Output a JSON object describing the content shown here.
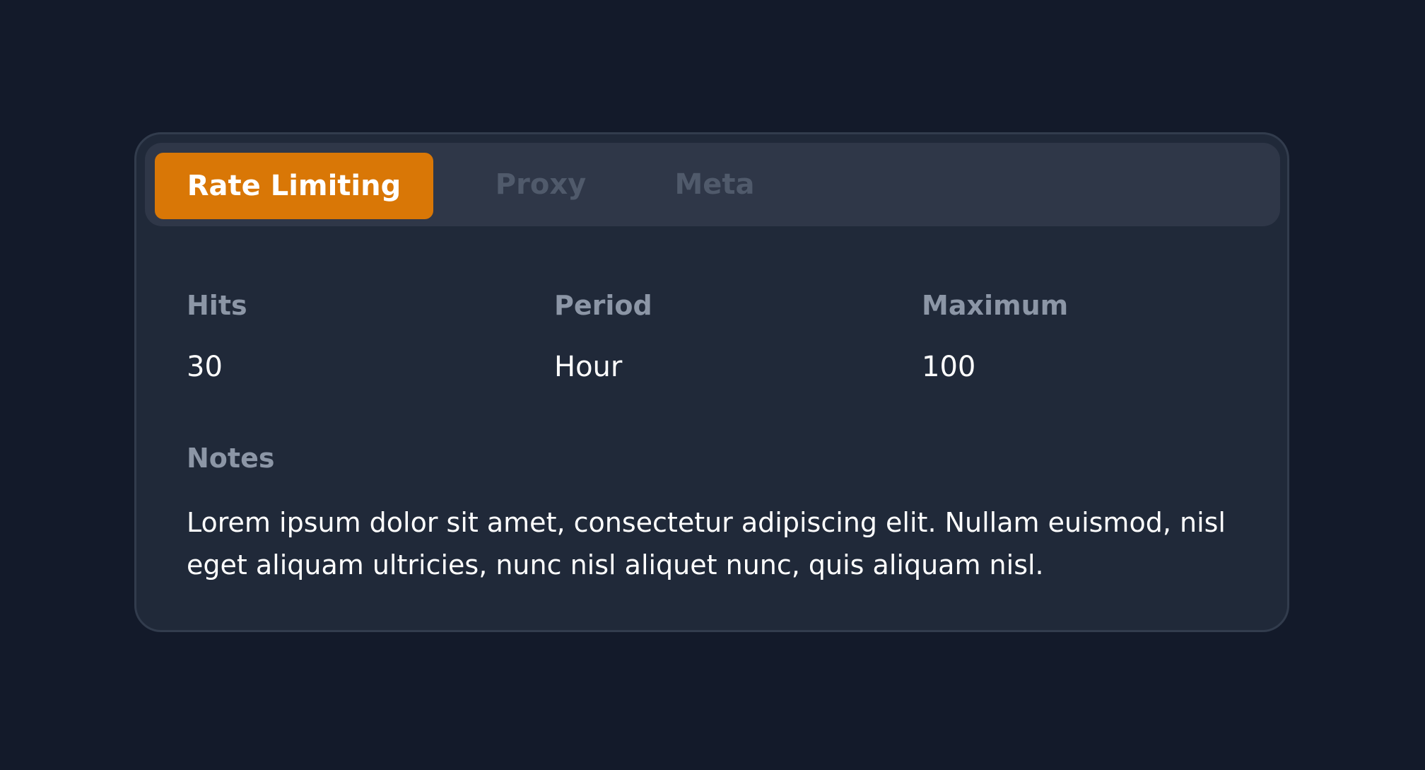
{
  "tabs": [
    {
      "label": "Rate Limiting",
      "active": true
    },
    {
      "label": "Proxy",
      "active": false
    },
    {
      "label": "Meta",
      "active": false
    }
  ],
  "fields": {
    "hits": {
      "label": "Hits",
      "value": "30"
    },
    "period": {
      "label": "Period",
      "value": "Hour"
    },
    "maximum": {
      "label": "Maximum",
      "value": "100"
    }
  },
  "notes": {
    "label": "Notes",
    "text": "Lorem ipsum dolor sit amet, consectetur adipiscing elit. Nullam euismod, nisl eget aliquam ultricies, nunc nisl aliquet nunc, quis aliquam nisl."
  },
  "colors": {
    "background": "#131a2a",
    "card": "#202939",
    "tab_bar": "#2f3748",
    "accent": "#d97706",
    "label": "#8c96a6",
    "value": "#ffffff",
    "inactive_tab": "#505a6b"
  }
}
